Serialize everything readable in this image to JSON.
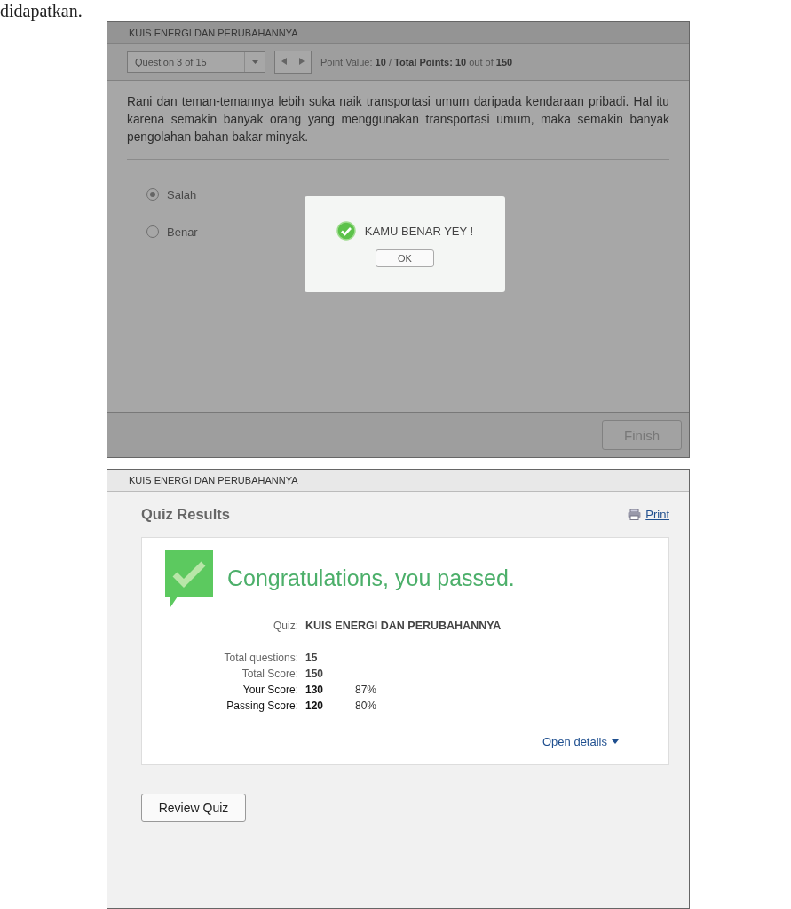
{
  "document_text": "didapatkan.",
  "quiz_screen": {
    "title": "KUIS ENERGI DAN PERUBAHANNYA",
    "question_select": "Question 3 of 15",
    "point_value_label": "Point Value:",
    "point_value": "10",
    "separator": "/",
    "total_points_label": "Total Points:",
    "total_points": "10",
    "out_of": "out of",
    "max_points": "150",
    "question": "Rani dan teman-temannya lebih suka naik transportasi umum daripada kendaraan pribadi. Hal itu karena semakin banyak orang yang menggunakan transportasi umum, maka semakin banyak pengolahan bahan bakar minyak.",
    "options": [
      {
        "label": "Salah",
        "selected": true
      },
      {
        "label": "Benar",
        "selected": false
      }
    ],
    "finish_button": "Finish",
    "dialog": {
      "message": "KAMU BENAR YEY !",
      "ok_button": "OK"
    }
  },
  "results_screen": {
    "title": "KUIS ENERGI DAN PERUBAHANNYA",
    "heading": "Quiz Results",
    "print_link": "Print",
    "message": "Congratulations, you passed.",
    "quiz_label": "Quiz:",
    "quiz_name": "KUIS ENERGI DAN PERUBAHANNYA",
    "rows": [
      {
        "label": "Total questions:",
        "value": "15",
        "kind": "plain"
      },
      {
        "label": "Total Score:",
        "value": "150",
        "kind": "plain"
      },
      {
        "label": "Your Score:",
        "value": "130",
        "percent": "87%",
        "kind": "strong"
      },
      {
        "label": "Passing Score:",
        "value": "120",
        "percent": "80%",
        "kind": "strong"
      }
    ],
    "details_link": "Open details",
    "review_button": "Review Quiz"
  }
}
